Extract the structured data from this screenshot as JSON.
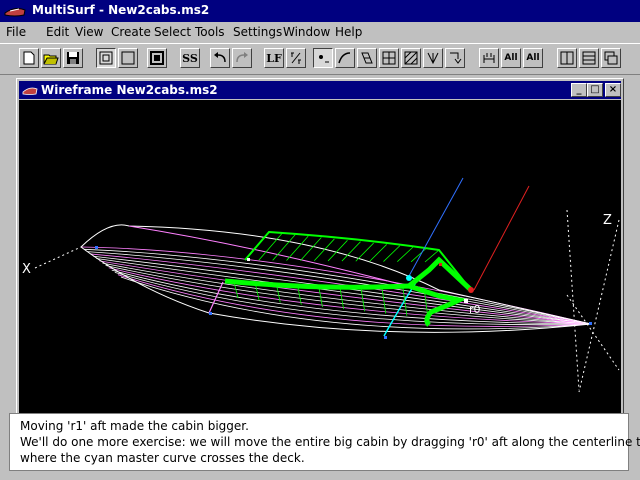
{
  "app": {
    "title": "MultiSurf - New2cabs.ms2"
  },
  "menu": [
    "File",
    "Edit",
    "View",
    "Create",
    "Select",
    "Tools",
    "Settings",
    "Window",
    "Help"
  ],
  "toolbar": {
    "ss_label": "SS",
    "lf_label": "LF",
    "all_label_1": "All",
    "all_label_2": "All"
  },
  "child_window": {
    "title": "Wireframe New2cabs.ms2",
    "minimize": "_",
    "maximize": "□",
    "close": "×"
  },
  "viewport": {
    "x_axis_label": "X",
    "z_axis_label": "Z",
    "point_label": "r0"
  },
  "message": {
    "line1": "Moving 'r1' aft made the cabin bigger.",
    "line2": "We'll do one more exercise: we will move the entire big cabin by dragging 'r0' aft along the centerline to",
    "line3": "where the cyan master curve crosses the deck."
  },
  "colors": {
    "title_bar": "#000080",
    "cabin_green": "#00ff00",
    "hull_white": "#ffffff",
    "hull_magenta": "#ff80ff",
    "master_cyan": "#00ffff",
    "axis_blue": "#3070ff",
    "axis_red": "#e02020",
    "viewport_bg": "#000000"
  }
}
